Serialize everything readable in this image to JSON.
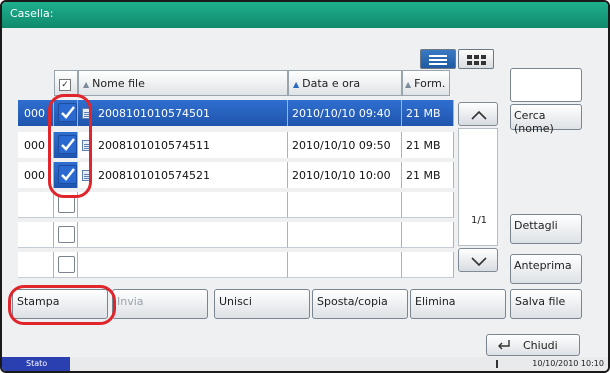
{
  "window": {
    "title": "Casella:"
  },
  "table": {
    "headers": {
      "name": "Nome file",
      "date": "Data e ora",
      "format": "Form."
    },
    "rows": [
      {
        "num": "000",
        "name": "2008101010574501",
        "date": "2010/10/10 09:40",
        "size": "21 MB",
        "checked": true
      },
      {
        "num": "000",
        "name": "2008101010574511",
        "date": "2010/10/10 09:50",
        "size": "21 MB",
        "checked": true
      },
      {
        "num": "000",
        "name": "2008101010574521",
        "date": "2010/10/10 10:00",
        "size": "21 MB",
        "checked": true
      }
    ],
    "page": "1/1"
  },
  "side": {
    "search": "Cerca (nome)",
    "details": "Dettagli",
    "preview": "Anteprima",
    "save": "Salva file"
  },
  "bottom": {
    "print": "Stampa",
    "send": "Invia",
    "join": "Unisci",
    "move": "Sposta/copia",
    "delete": "Elimina"
  },
  "close": "Chiudi",
  "status": {
    "label": "Stato",
    "datetime": "10/10/2010 10:10"
  },
  "colors": {
    "title": "#139b7b",
    "selected": "#2a66c8",
    "highlight": "#e0262c"
  }
}
